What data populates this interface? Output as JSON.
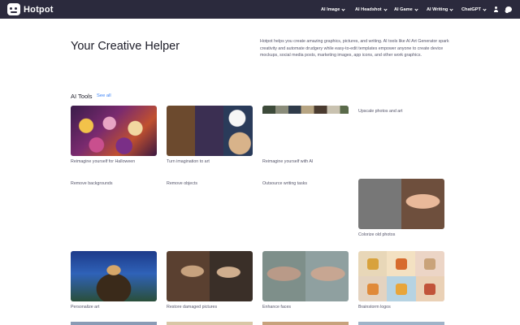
{
  "brand": {
    "name": "Hotpot"
  },
  "nav": {
    "items": [
      {
        "label": "AI Image"
      },
      {
        "label": "AI Headshot"
      },
      {
        "label": "AI Game"
      },
      {
        "label": "AI Writing"
      },
      {
        "label": "ChatGPT"
      }
    ]
  },
  "hero": {
    "title": "Your Creative Helper",
    "description": "Hotpot helps you create amazing graphics, pictures, and writing. AI tools like AI Art Generator spark creativity and automate drudgery while easy-to-edit templates empower anyone to create device mockups, social media posts, marketing images, app icons, and other work graphics."
  },
  "ai_tools": {
    "title": "AI Tools",
    "see_all": "See all",
    "items": [
      {
        "label": "Reimagine yourself for Halloween"
      },
      {
        "label": "Turn imagination to art"
      },
      {
        "label": "Reimagine yourself with AI"
      },
      {
        "label": "Upscale photos and art"
      },
      {
        "label": "Remove backgrounds"
      },
      {
        "label": "Remove objects"
      },
      {
        "label": "Outsource writing tasks"
      },
      {
        "label": "Colorize old photos"
      },
      {
        "label": "Personalize art"
      },
      {
        "label": "Restore damaged pictures"
      },
      {
        "label": "Enhance faces"
      },
      {
        "label": "Brainstorm logos"
      }
    ]
  },
  "colors": {
    "nav_bg": "#2b2a3d",
    "link": "#3b82f6"
  }
}
